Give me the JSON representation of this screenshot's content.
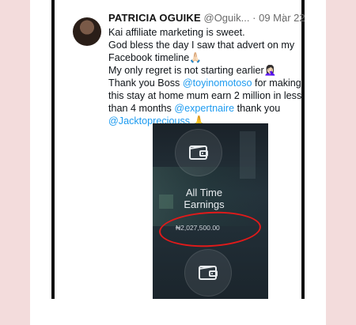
{
  "tweet": {
    "author_name": "PATRICIA OGUIKE",
    "handle": "@Oguik...",
    "separator": "·",
    "date": "09 Mar 22",
    "more_glyph": "⋮",
    "lines": [
      "Kai affiliate marketing is sweet.",
      "God bless the day I saw that advert on my",
      "Facebook timeline🙏🏻",
      "My only regret is not starting earlier🤦🏻‍♀️",
      "Thank you Boss ",
      "this stay at home mum earn 2 million in less",
      "than 4 months ",
      ""
    ],
    "mention_1": "@toyinomotoso",
    "after_mention_1": " for making",
    "mention_2": "@expertnaire",
    "after_mention_2": " thank you",
    "mention_3": "@Jacktopreciouss",
    "after_mention_3": " 🙏"
  },
  "media": {
    "title_line1": "All Time",
    "title_line2": "Earnings",
    "amount": "₦2,027,500.00",
    "highlight_color": "#e11a1a"
  },
  "colors": {
    "background": "#f3dcdc",
    "mention": "#1d9bf0",
    "media_bg": "#1f2b33"
  },
  "icons": [
    "avatar",
    "more-options-icon",
    "wallet-icon"
  ]
}
